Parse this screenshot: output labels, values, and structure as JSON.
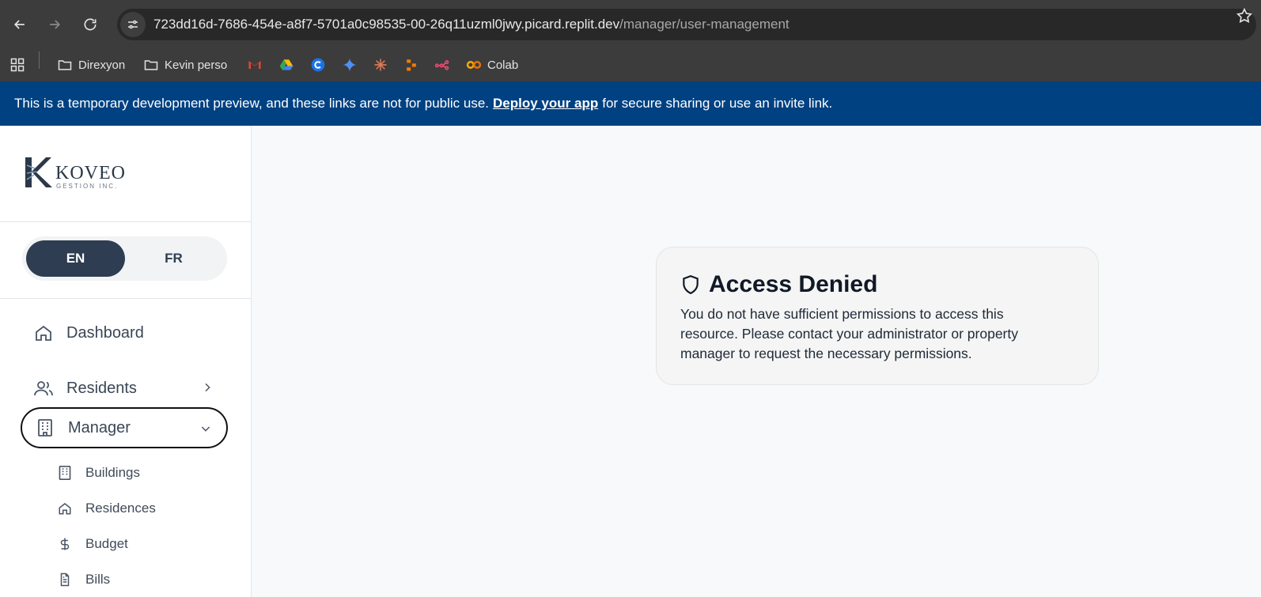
{
  "browser": {
    "url_host": "723dd16d-7686-454e-a8f7-5701a0c98535-00-26q11uzml0jwy.picard.replit.dev",
    "url_path": "/manager/user-management",
    "bookmarks": [
      {
        "label": "Direxyon",
        "icon": "folder-icon"
      },
      {
        "label": "Kevin perso",
        "icon": "folder-icon"
      },
      {
        "label": "",
        "icon": "gmail-icon"
      },
      {
        "label": "",
        "icon": "drive-icon"
      },
      {
        "label": "",
        "icon": "c-icon"
      },
      {
        "label": "",
        "icon": "gemini-icon"
      },
      {
        "label": "",
        "icon": "claude-icon"
      },
      {
        "label": "",
        "icon": "make-icon"
      },
      {
        "label": "",
        "icon": "n8n-icon"
      },
      {
        "label": "Colab",
        "icon": "colab-icon"
      }
    ]
  },
  "banner": {
    "text_before": "This is a temporary development preview, and these links are not for public use.",
    "link": "Deploy your app",
    "text_after": "for secure sharing or use an invite link."
  },
  "sidebar": {
    "logo_text": "KOVEO",
    "logo_sub": "GESTION INC.",
    "lang": {
      "en": "EN",
      "fr": "FR"
    },
    "nav": {
      "dashboard": "Dashboard",
      "residents": "Residents",
      "manager": "Manager"
    },
    "sub": {
      "buildings": "Buildings",
      "residences": "Residences",
      "budget": "Budget",
      "bills": "Bills"
    }
  },
  "card": {
    "title": "Access Denied",
    "body": "You do not have sufficient permissions to access this resource. Please contact your administrator or property manager to request the necessary permissions."
  },
  "colors": {
    "banner_bg": "#004182",
    "lang_active_bg": "#2e3d51"
  }
}
